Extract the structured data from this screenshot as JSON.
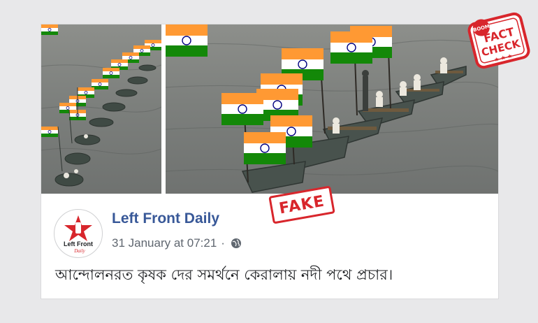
{
  "post": {
    "page_name": "Left Front Daily",
    "timestamp": "31 January at 07:21",
    "separator": "·",
    "privacy_icon": "globe-icon",
    "text": "আন্দোলনরত কৃষক দের সমর্থনে কেরালায় নদী পথে প্রচার।"
  },
  "avatar": {
    "logo_line1": "Left Front",
    "logo_line2": "Daily",
    "icon": "red-star-fist-icon"
  },
  "overlay": {
    "fake_label": "FAKE",
    "factcheck_brand": "BOOM",
    "factcheck_line1": "FACT",
    "factcheck_line2": "CHECK"
  },
  "colors": {
    "link_blue": "#385898",
    "stamp_red": "#d8262c",
    "saffron": "#ff9933",
    "flag_green": "#138808",
    "chakra_blue": "#000080"
  }
}
